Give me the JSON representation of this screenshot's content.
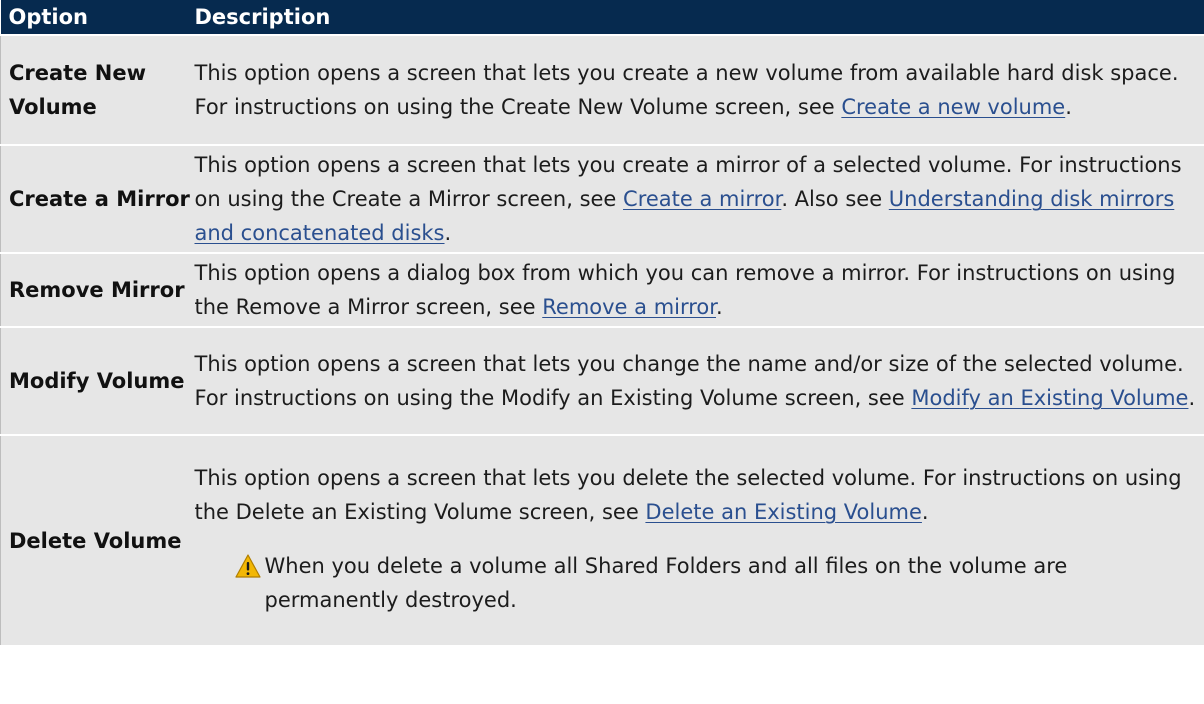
{
  "table": {
    "headers": [
      "Option",
      "Description"
    ],
    "rows": [
      {
        "option": "Create New Volume",
        "desc_pre": "This option opens a screen that lets you create a new volume from available hard disk space. For instructions on using the Create New Volume screen, see ",
        "link1": "Create a new volume",
        "desc_post": "."
      },
      {
        "option": "Create a Mirror",
        "desc_pre": "This option opens a screen that lets you create a mirror of a selected volume. For instructions on using the Create a Mirror screen, see ",
        "link1": "Create a mirror",
        "desc_mid": ". Also see ",
        "link2": "Understanding disk mirrors and concatenated disks",
        "desc_post": "."
      },
      {
        "option": "Remove Mirror",
        "desc_pre": "This option opens a dialog box from which you can remove a mirror. For instructions on using the Remove a Mirror screen, see ",
        "link1": "Remove a mirror",
        "desc_post": "."
      },
      {
        "option": "Modify Volume",
        "desc_pre": "This option opens a screen that lets you change the name and/or size of the selected volume. For instructions on using the Modify an Existing Volume screen, see ",
        "link1": "Modify an Existing Volume",
        "desc_post": "."
      },
      {
        "option": "Delete Volume",
        "desc_pre": "This option opens a screen that lets you delete the selected volume. For instructions on using the Delete an Existing Volume screen, see ",
        "link1": "Delete an Existing Volume",
        "desc_post": ".",
        "warning": "When you delete a volume all Shared Folders and all files on the volume are permanently destroyed.",
        "warning_icon": "warning-triangle-icon"
      }
    ]
  },
  "colors": {
    "header_bg": "#062a4f",
    "header_text": "#ffffff",
    "row_bg": "#e6e6e6",
    "link": "#2a4f8f",
    "warning_fill": "#f2b705"
  }
}
